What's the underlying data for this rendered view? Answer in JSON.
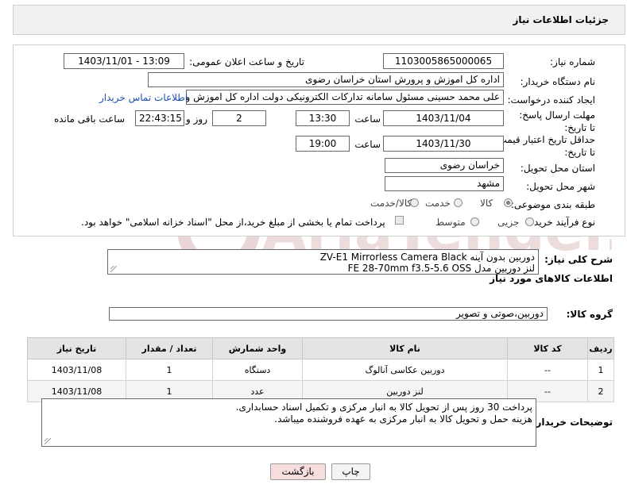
{
  "header": {
    "title": "جزئیات اطلاعات نیاز"
  },
  "labels": {
    "need_number": "شماره نیاز:",
    "announce_datetime": "تاریخ و ساعت اعلان عمومی:",
    "buyer_org": "نام دستگاه خریدار:",
    "requester": "ایجاد کننده درخواست:",
    "send_deadline": "مهلت ارسال پاسخ: تا تاریخ:",
    "time": "ساعت",
    "day_and": "روز و",
    "time_remaining": "ساعت باقی مانده",
    "price_validity": "حداقل تاریخ اعتبار قیمت: تا تاریخ:",
    "delivery_province": "استان محل تحویل:",
    "delivery_city": "شهر محل تحویل:",
    "category": "طبقه بندی موضوعی:",
    "purchase_type": "نوع فرآیند خرید :",
    "general_desc": "شرح کلی نیاز:",
    "goods_info": "اطلاعات کالاهای مورد نیاز",
    "goods_group": "گروه کالا:",
    "buyer_notes": "توضیحات خریدار:"
  },
  "values": {
    "need_number": "1103005865000065",
    "announce_datetime": "1403/11/01 - 13:09",
    "buyer_org": "اداره کل اموزش و پرورش استان خراسان رضوی",
    "requester": "علی محمد حسینی مسئول سامانه تدارکات الکترونیکی دولت اداره کل اموزش و",
    "contact_link": "اطلاعات تماس خریدار",
    "send_date": "1403/11/04",
    "send_time": "13:30",
    "days": "2",
    "remaining": "22:43:15",
    "validity_date": "1403/11/30",
    "validity_time": "19:00",
    "province": "خراسان رضوی",
    "city": "مشهد",
    "general_desc_line1": "دوربین بدون آینه   ZV-E1 Mirrorless Camera Black",
    "general_desc_line2": "لنز دوربین مدل FE 28-70mm f3.5-5.6 OSS",
    "goods_group": "دوربین،صوتی و تصویر",
    "notes_line1": "پرداخت 30 روز پس از تحویل کالا به انبار مرکزی و تکمیل اسناد حسابداری.",
    "notes_line2": "هزینه حمل و تحویل کالا به انبار مرکزی به عهده فروشنده میباشد."
  },
  "category_options": [
    {
      "label": "کالا",
      "selected": true
    },
    {
      "label": "خدمت",
      "selected": false
    },
    {
      "label": "کالا/خدمت",
      "selected": false
    }
  ],
  "purchase_options": [
    {
      "label": "جزیی",
      "selected": false
    },
    {
      "label": "متوسط",
      "selected": false
    }
  ],
  "payment_note": "پرداخت تمام یا بخشی از مبلغ خرید،از محل \"اسناد خزانه اسلامی\" خواهد بود.",
  "table": {
    "headers": [
      "ردیف",
      "کد کالا",
      "نام کالا",
      "واحد شمارش",
      "تعداد / مقدار",
      "تاریخ نیاز"
    ],
    "rows": [
      [
        "1",
        "--",
        "دوربین عکاسی آنالوگ",
        "دستگاه",
        "1",
        "1403/11/08"
      ],
      [
        "2",
        "--",
        "لنز دوربین",
        "عدد",
        "1",
        "1403/11/08"
      ]
    ]
  },
  "buttons": {
    "print": "چاپ",
    "back": "بازگشت"
  },
  "watermark": {
    "text": "AriaTender.net"
  },
  "colors": {
    "link": "#1b4fae",
    "back_button": "#f7dede",
    "watermark": "#e9d4d4"
  }
}
